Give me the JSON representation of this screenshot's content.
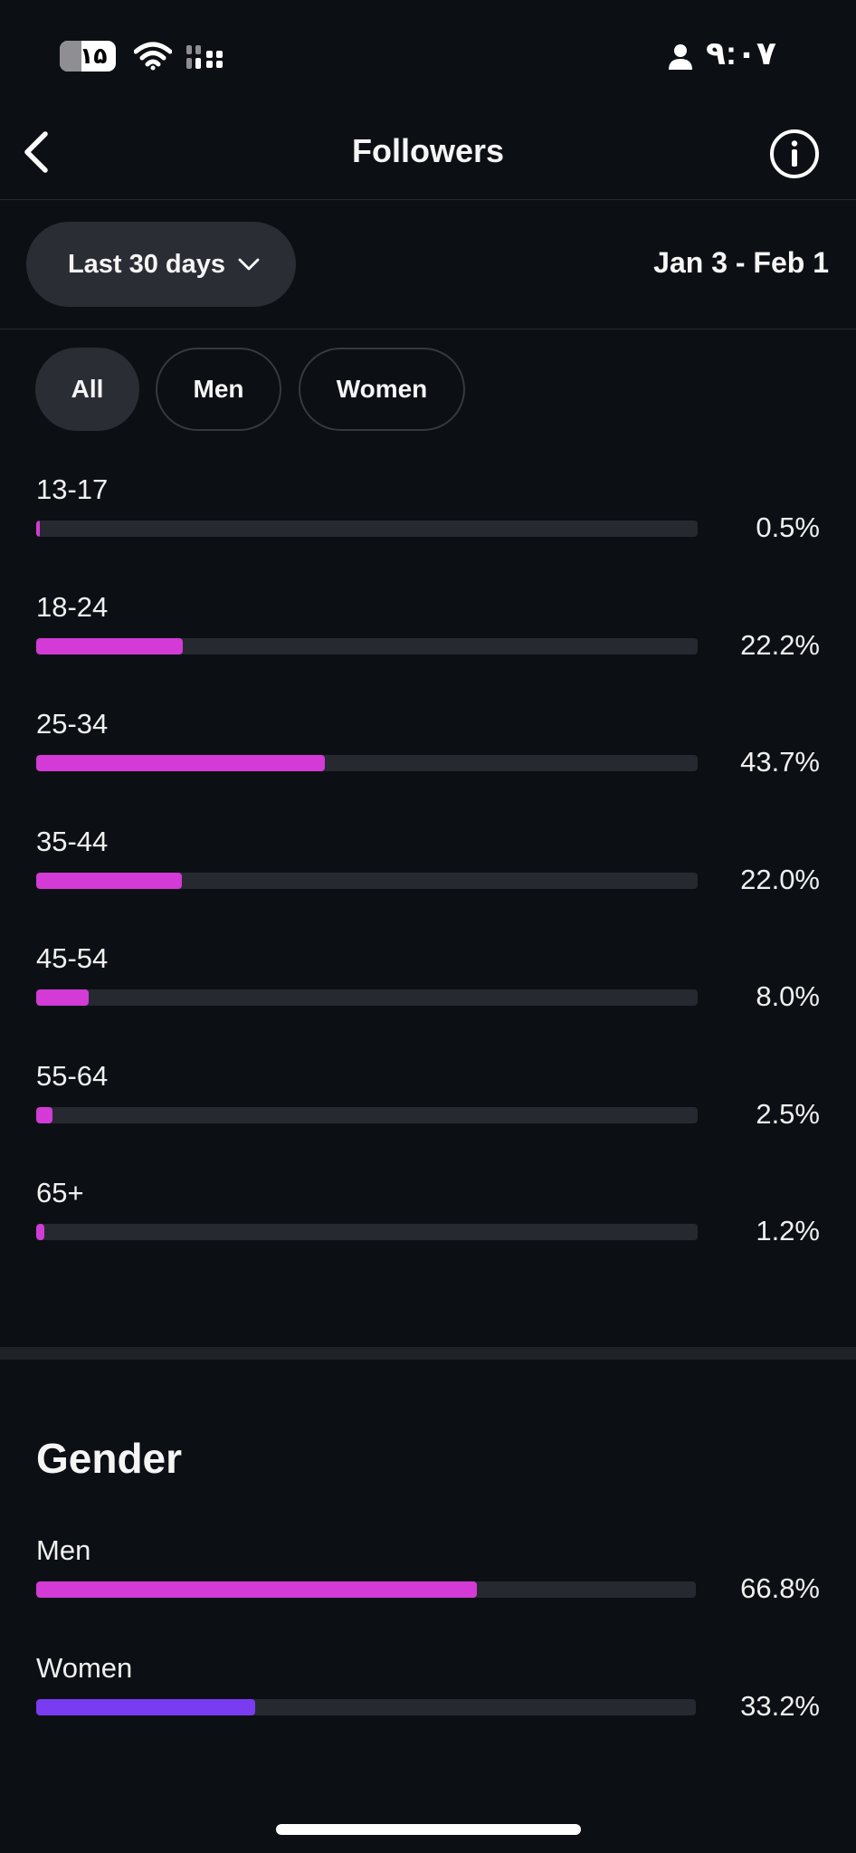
{
  "status_bar": {
    "time": "۹:۰۷",
    "battery": "۱۵",
    "icons": [
      "person-icon",
      "wifi-icon",
      "signal-icon",
      "battery-icon"
    ]
  },
  "header": {
    "title": "Followers",
    "back_icon": "chevron-left-icon",
    "info_icon": "info-icon"
  },
  "filter": {
    "period_label": "Last 30 days",
    "date_range": "Jan 3 - Feb 1"
  },
  "segments": [
    {
      "label": "All",
      "active": true
    },
    {
      "label": "Men",
      "active": false
    },
    {
      "label": "Women",
      "active": false
    }
  ],
  "age": {
    "rows": [
      {
        "label": "13-17",
        "value": 0.5,
        "display": "0.5%"
      },
      {
        "label": "18-24",
        "value": 22.2,
        "display": "22.2%"
      },
      {
        "label": "25-34",
        "value": 43.7,
        "display": "43.7%"
      },
      {
        "label": "35-44",
        "value": 22.0,
        "display": "22.0%"
      },
      {
        "label": "45-54",
        "value": 8.0,
        "display": "8.0%"
      },
      {
        "label": "55-64",
        "value": 2.5,
        "display": "2.5%"
      },
      {
        "label": "65+",
        "value": 1.2,
        "display": "1.2%"
      }
    ]
  },
  "gender": {
    "title": "Gender",
    "rows": [
      {
        "label": "Men",
        "value": 66.8,
        "display": "66.8%",
        "color": "#d33ad6"
      },
      {
        "label": "Women",
        "value": 33.2,
        "display": "33.2%",
        "color": "#7a3cf0"
      }
    ]
  },
  "colors": {
    "background": "#0c1014",
    "bar_pink": "#d33ad6",
    "bar_purple": "#7a3cf0",
    "track": "#262a30"
  }
}
